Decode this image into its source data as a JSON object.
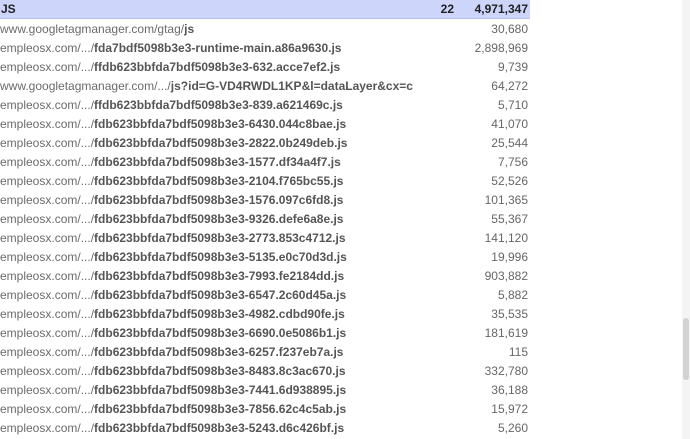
{
  "header": {
    "type_label": "JS",
    "count": "22",
    "total_size": "4,971,347"
  },
  "rows": [
    {
      "domain": "www.googletagmanager.com/gtag/",
      "path": "js",
      "size": "30,680"
    },
    {
      "domain": "empleosx.com/.../",
      "path": "fda7bdf5098b3e3-runtime-main.a86a9630.js",
      "size": "2,898,969"
    },
    {
      "domain": "empleosx.com/.../",
      "path": "ffdb623bbfda7bdf5098b3e3-632.acce7ef2.js",
      "size": "9,739"
    },
    {
      "domain": "www.googletagmanager.com/.../",
      "path": "js?id=G-VD4RWDL1KP&l=dataLayer&cx=c",
      "size": "64,272"
    },
    {
      "domain": "empleosx.com/.../",
      "path": "ffdb623bbfda7bdf5098b3e3-839.a621469c.js",
      "size": "5,710"
    },
    {
      "domain": "empleosx.com/.../",
      "path": "fdb623bbfda7bdf5098b3e3-6430.044c8bae.js",
      "size": "41,070"
    },
    {
      "domain": "empleosx.com/.../",
      "path": "fdb623bbfda7bdf5098b3e3-2822.0b249deb.js",
      "size": "25,544"
    },
    {
      "domain": "empleosx.com/.../",
      "path": "fdb623bbfda7bdf5098b3e3-1577.df34a4f7.js",
      "size": "7,756"
    },
    {
      "domain": "empleosx.com/.../",
      "path": "fdb623bbfda7bdf5098b3e3-2104.f765bc55.js",
      "size": "52,526"
    },
    {
      "domain": "empleosx.com/.../",
      "path": "fdb623bbfda7bdf5098b3e3-1576.097c6fd8.js",
      "size": "101,365"
    },
    {
      "domain": "empleosx.com/.../",
      "path": "fdb623bbfda7bdf5098b3e3-9326.defe6a8e.js",
      "size": "55,367"
    },
    {
      "domain": "empleosx.com/.../",
      "path": "fdb623bbfda7bdf5098b3e3-2773.853c4712.js",
      "size": "141,120"
    },
    {
      "domain": "empleosx.com/.../",
      "path": "fdb623bbfda7bdf5098b3e3-5135.e0c70d3d.js",
      "size": "19,996"
    },
    {
      "domain": "empleosx.com/.../",
      "path": "fdb623bbfda7bdf5098b3e3-7993.fe2184dd.js",
      "size": "903,882"
    },
    {
      "domain": "empleosx.com/.../",
      "path": "fdb623bbfda7bdf5098b3e3-6547.2c60d45a.js",
      "size": "5,882"
    },
    {
      "domain": "empleosx.com/.../",
      "path": "fdb623bbfda7bdf5098b3e3-4982.cdbd90fe.js",
      "size": "35,535"
    },
    {
      "domain": "empleosx.com/.../",
      "path": "fdb623bbfda7bdf5098b3e3-6690.0e5086b1.js",
      "size": "181,619"
    },
    {
      "domain": "empleosx.com/.../",
      "path": "fdb623bbfda7bdf5098b3e3-6257.f237eb7a.js",
      "size": "115"
    },
    {
      "domain": "empleosx.com/.../",
      "path": "fdb623bbfda7bdf5098b3e3-8483.8c3ac670.js",
      "size": "332,780"
    },
    {
      "domain": "empleosx.com/.../",
      "path": "fdb623bbfda7bdf5098b3e3-7441.6d938895.js",
      "size": "36,188"
    },
    {
      "domain": "empleosx.com/.../",
      "path": "fdb623bbfda7bdf5098b3e3-7856.62c4c5ab.js",
      "size": "15,972"
    },
    {
      "domain": "empleosx.com/.../",
      "path": "fdb623bbfda7bdf5098b3e3-5243.d6c426bf.js",
      "size": "5,260"
    }
  ],
  "colors": {
    "header_background": "#cdd5fb",
    "text": "#555555"
  }
}
